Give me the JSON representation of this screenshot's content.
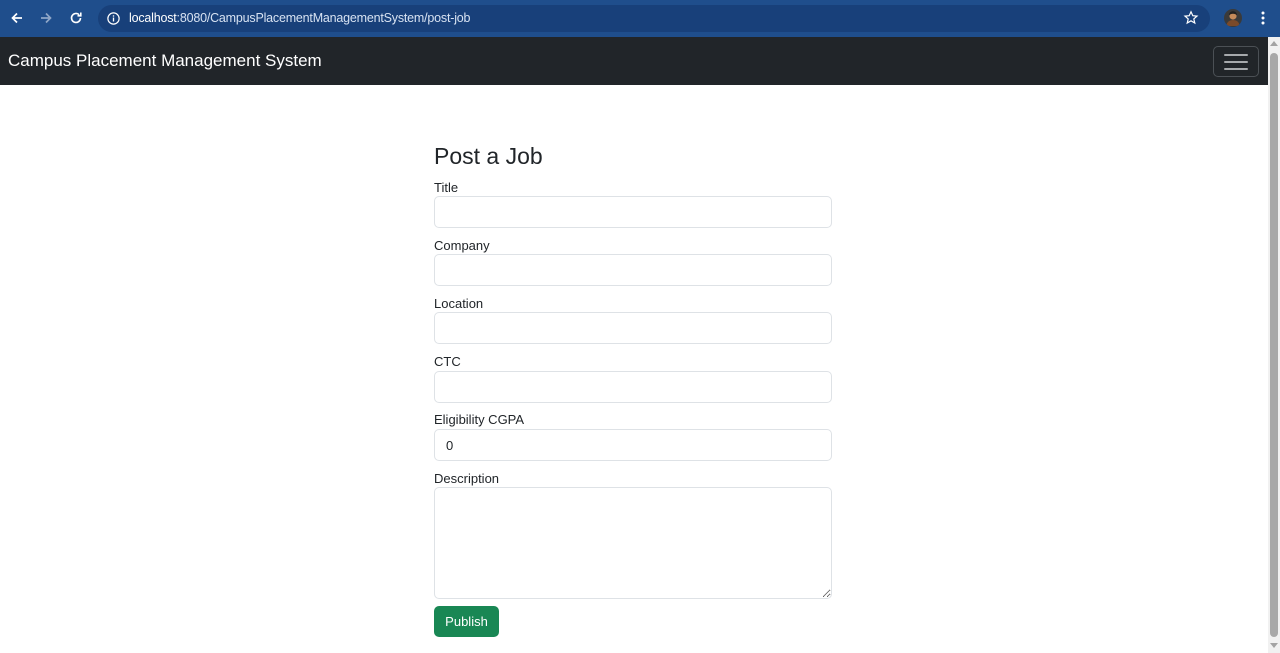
{
  "browser": {
    "url_host": "localhost",
    "url_path": ":8080/CampusPlacementManagementSystem/post-job",
    "icons": {
      "back": "back-arrow-icon",
      "forward": "forward-arrow-icon",
      "reload": "reload-icon",
      "site_info": "info-icon",
      "bookmark": "star-icon",
      "profile": "avatar",
      "menu": "more-vert-icon"
    }
  },
  "navbar": {
    "brand": "Campus Placement Management System",
    "toggler_icon": "hamburger-icon"
  },
  "form": {
    "title": "Post a Job",
    "fields": [
      {
        "label": "Title",
        "value": ""
      },
      {
        "label": "Company",
        "value": ""
      },
      {
        "label": "Location",
        "value": ""
      },
      {
        "label": "CTC",
        "value": ""
      },
      {
        "label": "Eligibility CGPA",
        "value": "0"
      },
      {
        "label": "Description",
        "value": ""
      }
    ],
    "submit_label": "Publish"
  },
  "colors": {
    "browser_bar": "#1f4e8c",
    "navbar": "#212529",
    "primary_button": "#198754"
  }
}
